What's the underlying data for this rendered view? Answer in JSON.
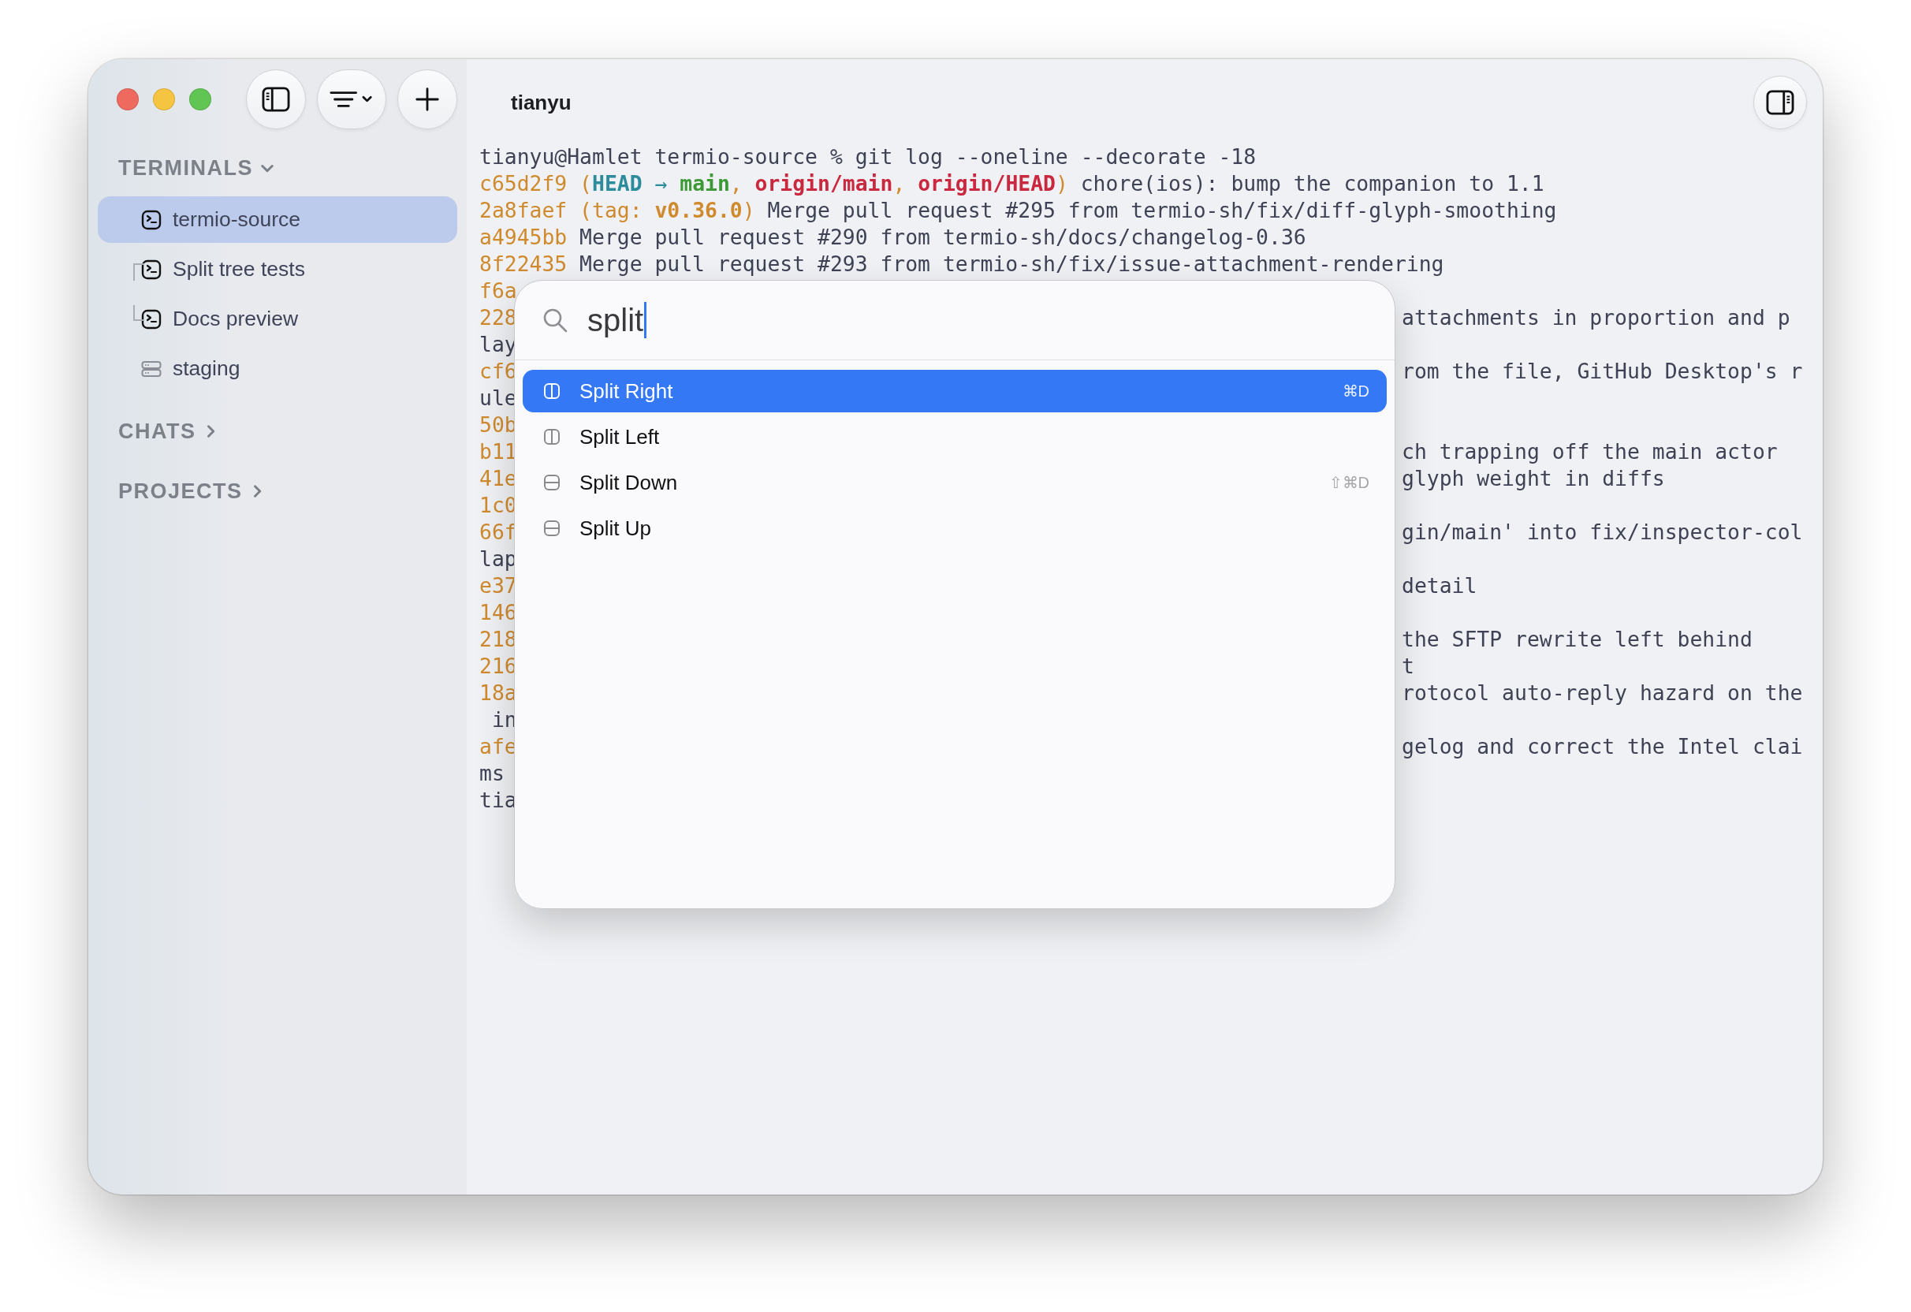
{
  "window": {
    "title": "tianyu"
  },
  "sidebar": {
    "sections": [
      {
        "title": "TERMINALS",
        "expanded": true,
        "items": [
          {
            "kind": "terminal",
            "label": "termio-source",
            "selected": true
          },
          {
            "kind": "split",
            "children": [
              {
                "kind": "terminal",
                "label": "Split tree tests",
                "selected": false
              },
              {
                "kind": "terminal",
                "label": "Docs preview",
                "selected": false
              }
            ]
          },
          {
            "kind": "server",
            "label": "staging",
            "selected": false
          }
        ]
      },
      {
        "title": "CHATS",
        "expanded": false
      },
      {
        "title": "PROJECTS",
        "expanded": false
      }
    ]
  },
  "terminal": {
    "lines": [
      {
        "kind": "full",
        "segments": [
          {
            "text": "tianyu@Hamlet termio-source % git log --oneline --decorate -18",
            "kind": "plain"
          }
        ]
      },
      {
        "kind": "full",
        "segments": [
          {
            "text": "c65d2f9",
            "kind": "hash"
          },
          {
            "text": " (",
            "kind": "deco"
          },
          {
            "text": "HEAD",
            "kind": "head"
          },
          {
            "text": " → ",
            "kind": "arrow"
          },
          {
            "text": "main",
            "kind": "branch"
          },
          {
            "text": ", ",
            "kind": "deco"
          },
          {
            "text": "origin/main",
            "kind": "remote"
          },
          {
            "text": ", ",
            "kind": "deco"
          },
          {
            "text": "origin/HEAD",
            "kind": "remote"
          },
          {
            "text": ")",
            "kind": "deco"
          },
          {
            "text": " chore(ios): bump the companion to 1.1",
            "kind": "plain"
          }
        ]
      },
      {
        "kind": "full",
        "segments": [
          {
            "text": "2a8faef",
            "kind": "hash"
          },
          {
            "text": " (tag: ",
            "kind": "deco"
          },
          {
            "text": "v0.36.0",
            "kind": "tag"
          },
          {
            "text": ")",
            "kind": "deco"
          },
          {
            "text": " Merge pull request #295 from termio-sh/fix/diff-glyph-smoothing",
            "kind": "plain"
          }
        ]
      },
      {
        "kind": "full",
        "segments": [
          {
            "text": "a4945bb",
            "kind": "hash"
          },
          {
            "text": " Merge pull request #290 from termio-sh/docs/changelog-0.36",
            "kind": "plain"
          }
        ]
      },
      {
        "kind": "full",
        "segments": [
          {
            "text": "8f22435",
            "kind": "hash"
          },
          {
            "text": " Merge pull request #293 from termio-sh/fix/issue-attachment-rendering",
            "kind": "plain"
          }
        ]
      },
      {
        "kind": "covered",
        "left": {
          "text": "f6a",
          "kind": "hash"
        }
      },
      {
        "kind": "covered",
        "left": {
          "text": "228",
          "kind": "hash"
        },
        "right": "attachments in proportion and p"
      },
      {
        "kind": "covered",
        "left": {
          "text": "lay",
          "kind": "plain"
        }
      },
      {
        "kind": "covered",
        "left": {
          "text": "cf6",
          "kind": "hash"
        },
        "right": "rom the file, GitHub Desktop's r"
      },
      {
        "kind": "covered",
        "left": {
          "text": "ule",
          "kind": "plain"
        }
      },
      {
        "kind": "covered",
        "left": {
          "text": "50b",
          "kind": "hash"
        }
      },
      {
        "kind": "covered",
        "left": {
          "text": "b11",
          "kind": "hash"
        },
        "right": "ch trapping off the main actor"
      },
      {
        "kind": "covered",
        "left": {
          "text": "41e",
          "kind": "hash"
        },
        "right": "glyph weight in diffs"
      },
      {
        "kind": "covered",
        "left": {
          "text": "1c0",
          "kind": "hash"
        }
      },
      {
        "kind": "covered",
        "left": {
          "text": "66f",
          "kind": "hash"
        },
        "right": "gin/main' into fix/inspector-col"
      },
      {
        "kind": "covered",
        "left": {
          "text": "lap",
          "kind": "plain"
        }
      },
      {
        "kind": "covered",
        "left": {
          "text": "e37",
          "kind": "hash"
        },
        "right": "detail"
      },
      {
        "kind": "covered",
        "left": {
          "text": "146",
          "kind": "hash"
        }
      },
      {
        "kind": "covered",
        "left": {
          "text": "218",
          "kind": "hash"
        },
        "right": "the SFTP rewrite left behind"
      },
      {
        "kind": "covered",
        "left": {
          "text": "216",
          "kind": "hash"
        },
        "right": "t"
      },
      {
        "kind": "covered",
        "left": {
          "text": "18a",
          "kind": "hash"
        },
        "right": "rotocol auto-reply hazard on the"
      },
      {
        "kind": "covered",
        "left": {
          "text": " in",
          "kind": "plain"
        }
      },
      {
        "kind": "covered",
        "left": {
          "text": "afe",
          "kind": "hash"
        },
        "right": "gelog and correct the Intel clai"
      },
      {
        "kind": "covered",
        "left": {
          "text": "ms",
          "kind": "plain"
        }
      },
      {
        "kind": "covered",
        "left": {
          "text": "tia",
          "kind": "plain"
        }
      }
    ]
  },
  "palette": {
    "query": "split",
    "items": [
      {
        "label": "Split Right",
        "kind": "vertical",
        "shortcut": "⌘D",
        "selected": true
      },
      {
        "label": "Split Left",
        "kind": "vertical",
        "selected": false
      },
      {
        "label": "Split Down",
        "kind": "horizontal",
        "shortcut": "⇧⌘D",
        "selected": false
      },
      {
        "label": "Split Up",
        "kind": "horizontal",
        "selected": false
      }
    ]
  }
}
